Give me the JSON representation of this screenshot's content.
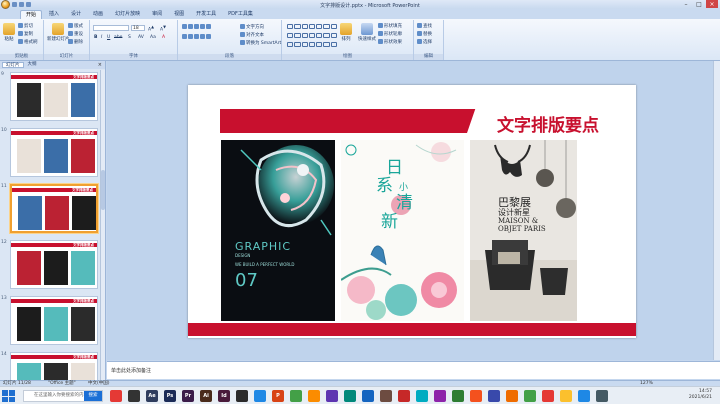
{
  "window": {
    "title": "文字排版设计.pptx - Microsoft PowerPoint"
  },
  "ribbon_tabs": [
    "开始",
    "插入",
    "设计",
    "动画",
    "幻灯片放映",
    "审阅",
    "视图",
    "开发工具",
    "PDF工具集"
  ],
  "ribbon": {
    "clipboard": {
      "name": "剪贴板",
      "paste": "粘贴",
      "cut": "剪切",
      "copy": "复制",
      "format": "格式刷"
    },
    "slides": {
      "name": "幻灯片",
      "new": "新建幻灯片",
      "layout": "版式",
      "reset": "重设",
      "delete": "删除"
    },
    "font": {
      "name": "字体",
      "font_value": "",
      "size_value": "18"
    },
    "paragraph": {
      "name": "段落",
      "text_dir": "文字方向",
      "align_text": "对齐文本",
      "smartart": "转换为 SmartArt"
    },
    "drawing": {
      "name": "绘图",
      "arrange": "排列",
      "quick_styles": "快速样式",
      "fill": "形状填充",
      "outline": "形状轮廓",
      "effects": "形状效果"
    },
    "editing": {
      "name": "编辑",
      "find": "查找",
      "replace": "替换",
      "select": "选择"
    }
  },
  "left_pane": {
    "tab_slides": "幻灯片",
    "tab_outline": "大纲",
    "close": "×",
    "thumbnails": [
      {
        "num": "9",
        "title": "文字排版要点"
      },
      {
        "num": "10",
        "title": "文字排版要点"
      },
      {
        "num": "11",
        "title": "文字排版要点"
      },
      {
        "num": "12",
        "title": "文字排版要点"
      },
      {
        "num": "13",
        "title": "文字排版要点"
      },
      {
        "num": "14",
        "title": "文字排版要点"
      }
    ]
  },
  "slide": {
    "title": "文字排版要点",
    "image1": {
      "word": "GRAPHIC",
      "sub1": "DESIGN",
      "sub2": "WE BUILD A PERFECT WORLD",
      "num": "07"
    },
    "image2": {
      "line1": "日",
      "line2": "系",
      "line3": "小",
      "line4": "清",
      "line5": "新"
    },
    "image3": {
      "line1": "巴黎展",
      "line2": "设计新星",
      "line3": "MAISON &",
      "line4": "OBJET PARIS"
    }
  },
  "notes": {
    "placeholder": "单击此处添加备注"
  },
  "status": {
    "slide_info": "幻灯片 11/28",
    "theme": "\"Office 主题\"",
    "language": "中文(中国)",
    "zoom": "127%"
  },
  "taskbar": {
    "search_placeholder": "在这里输入你要搜索的内容",
    "search_button": "搜索",
    "time": "14:57",
    "date": "2021/6/21"
  },
  "colors": {
    "accent_red": "#c8102e",
    "office_blue": "#c9daf0"
  }
}
